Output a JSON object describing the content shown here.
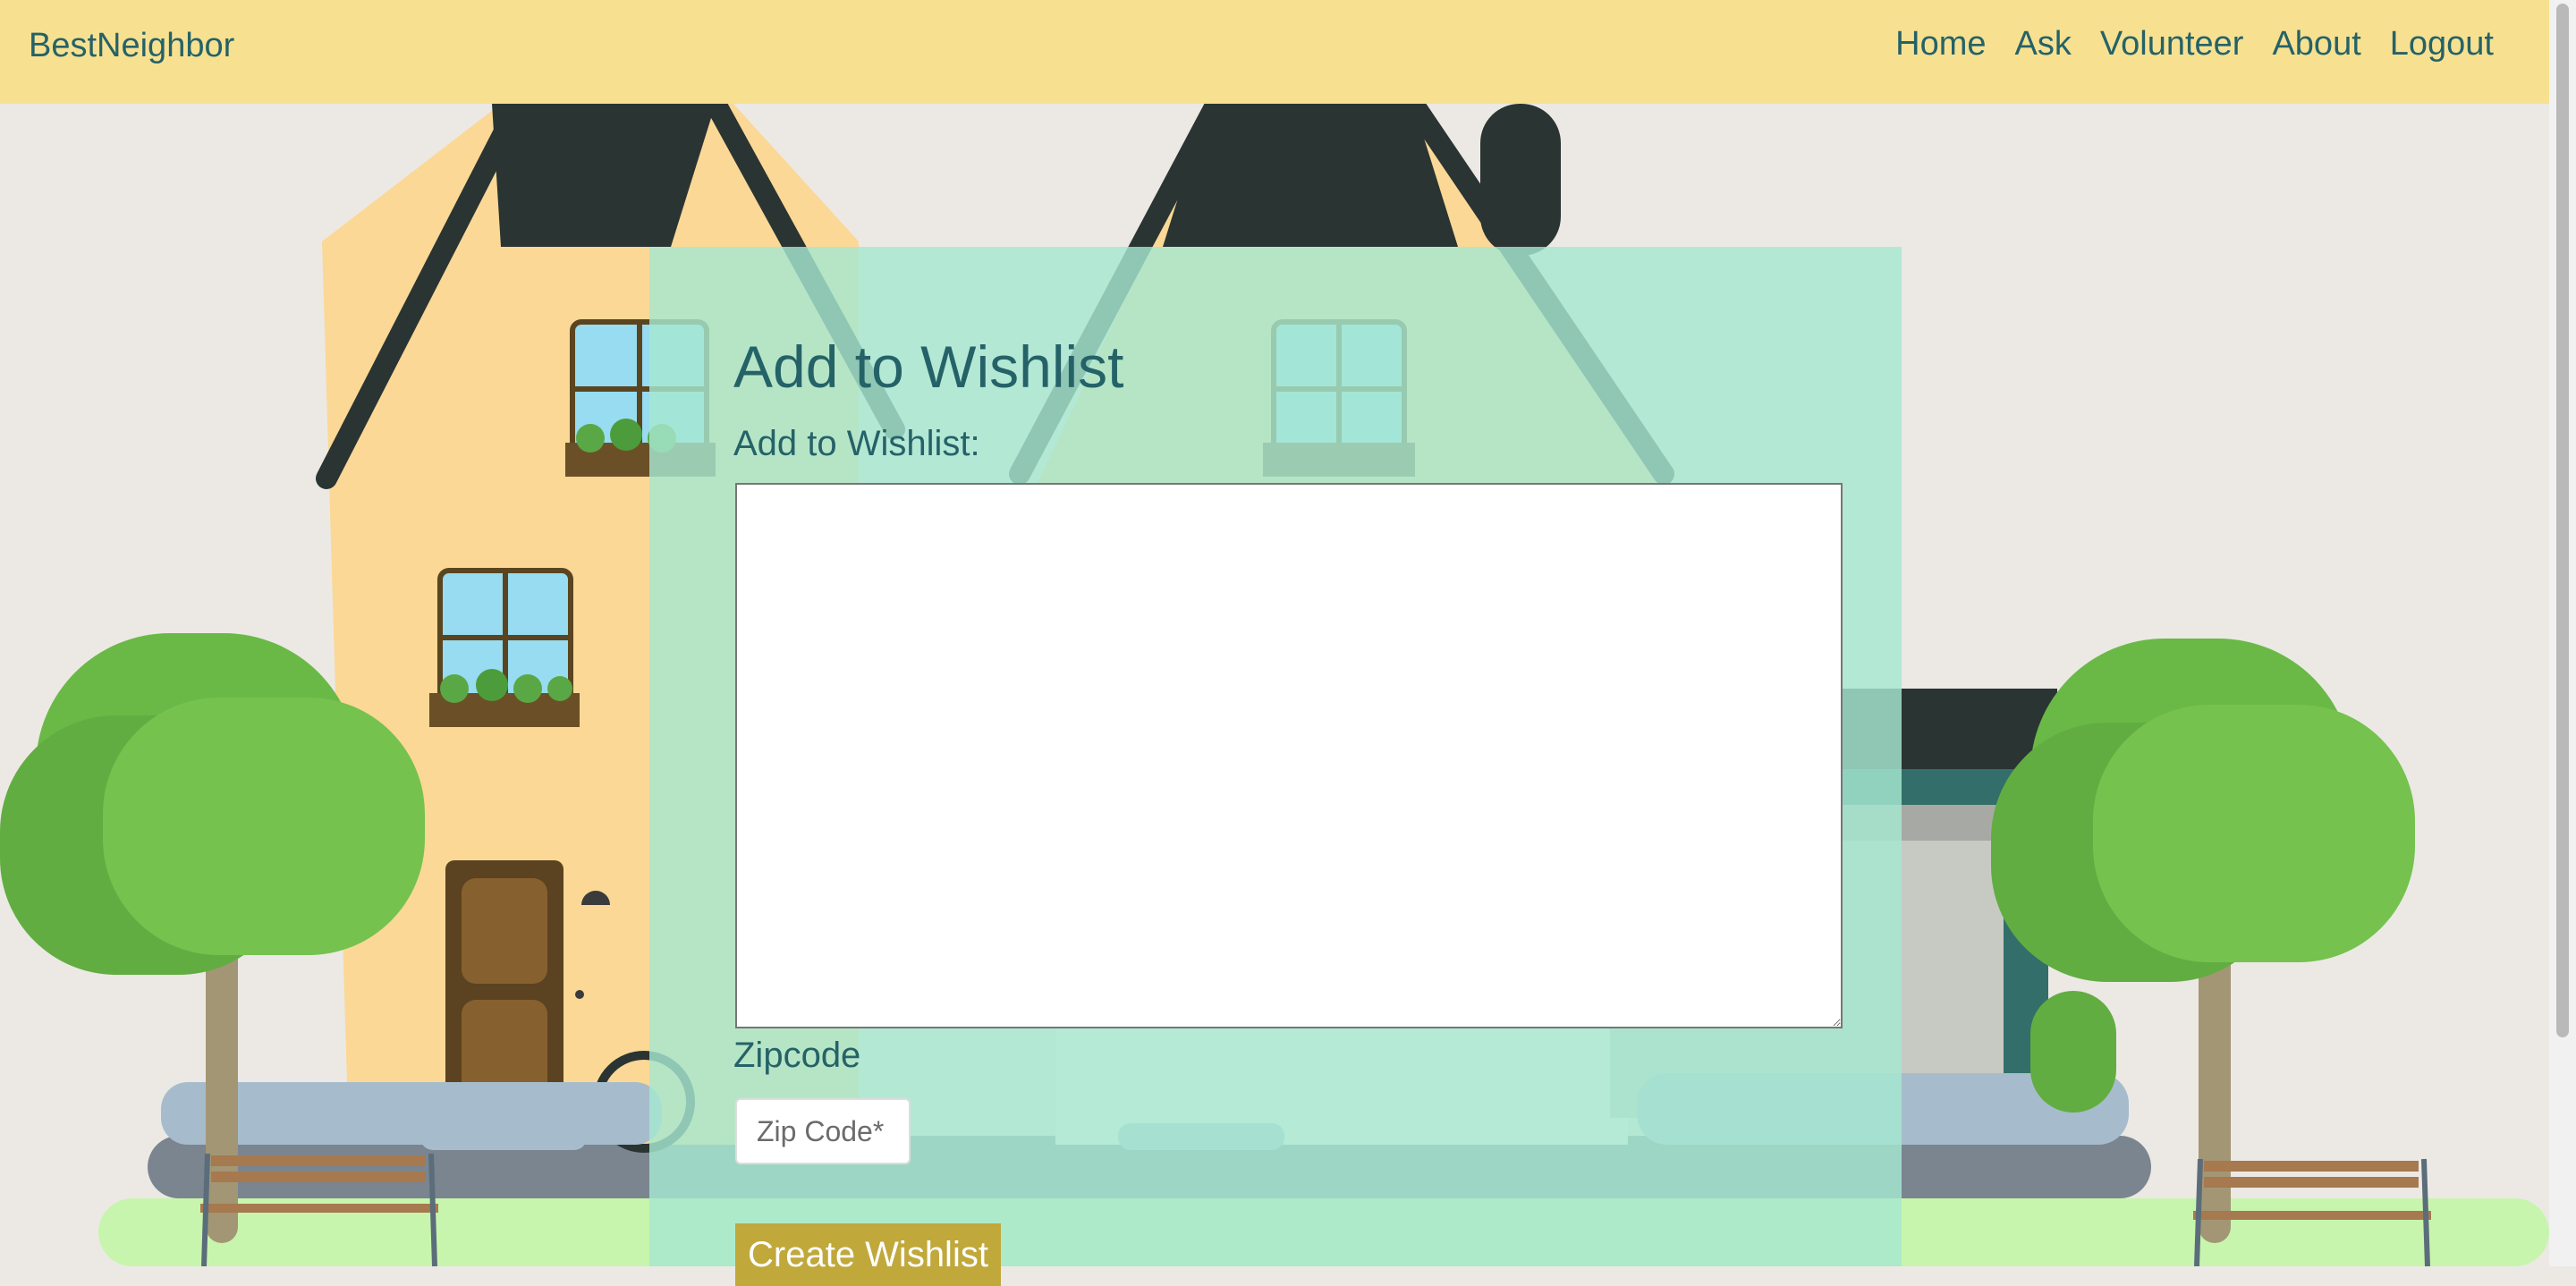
{
  "nav": {
    "brand": "BestNeighbor",
    "links": [
      "Home",
      "Ask",
      "Volunteer",
      "About",
      "Logout"
    ]
  },
  "form": {
    "title": "Add to Wishlist",
    "wishlist_label": "Add to Wishlist:",
    "wishlist_value": "",
    "zip_label": "Zipcode",
    "zip_placeholder": "Zip Code*",
    "zip_value": "",
    "submit_label": "Create Wishlist"
  },
  "colors": {
    "navbar_bg": "#f7e191",
    "brand_text": "#256268",
    "panel_bg": "#a6e8d1",
    "button_bg": "#c0a83b"
  }
}
